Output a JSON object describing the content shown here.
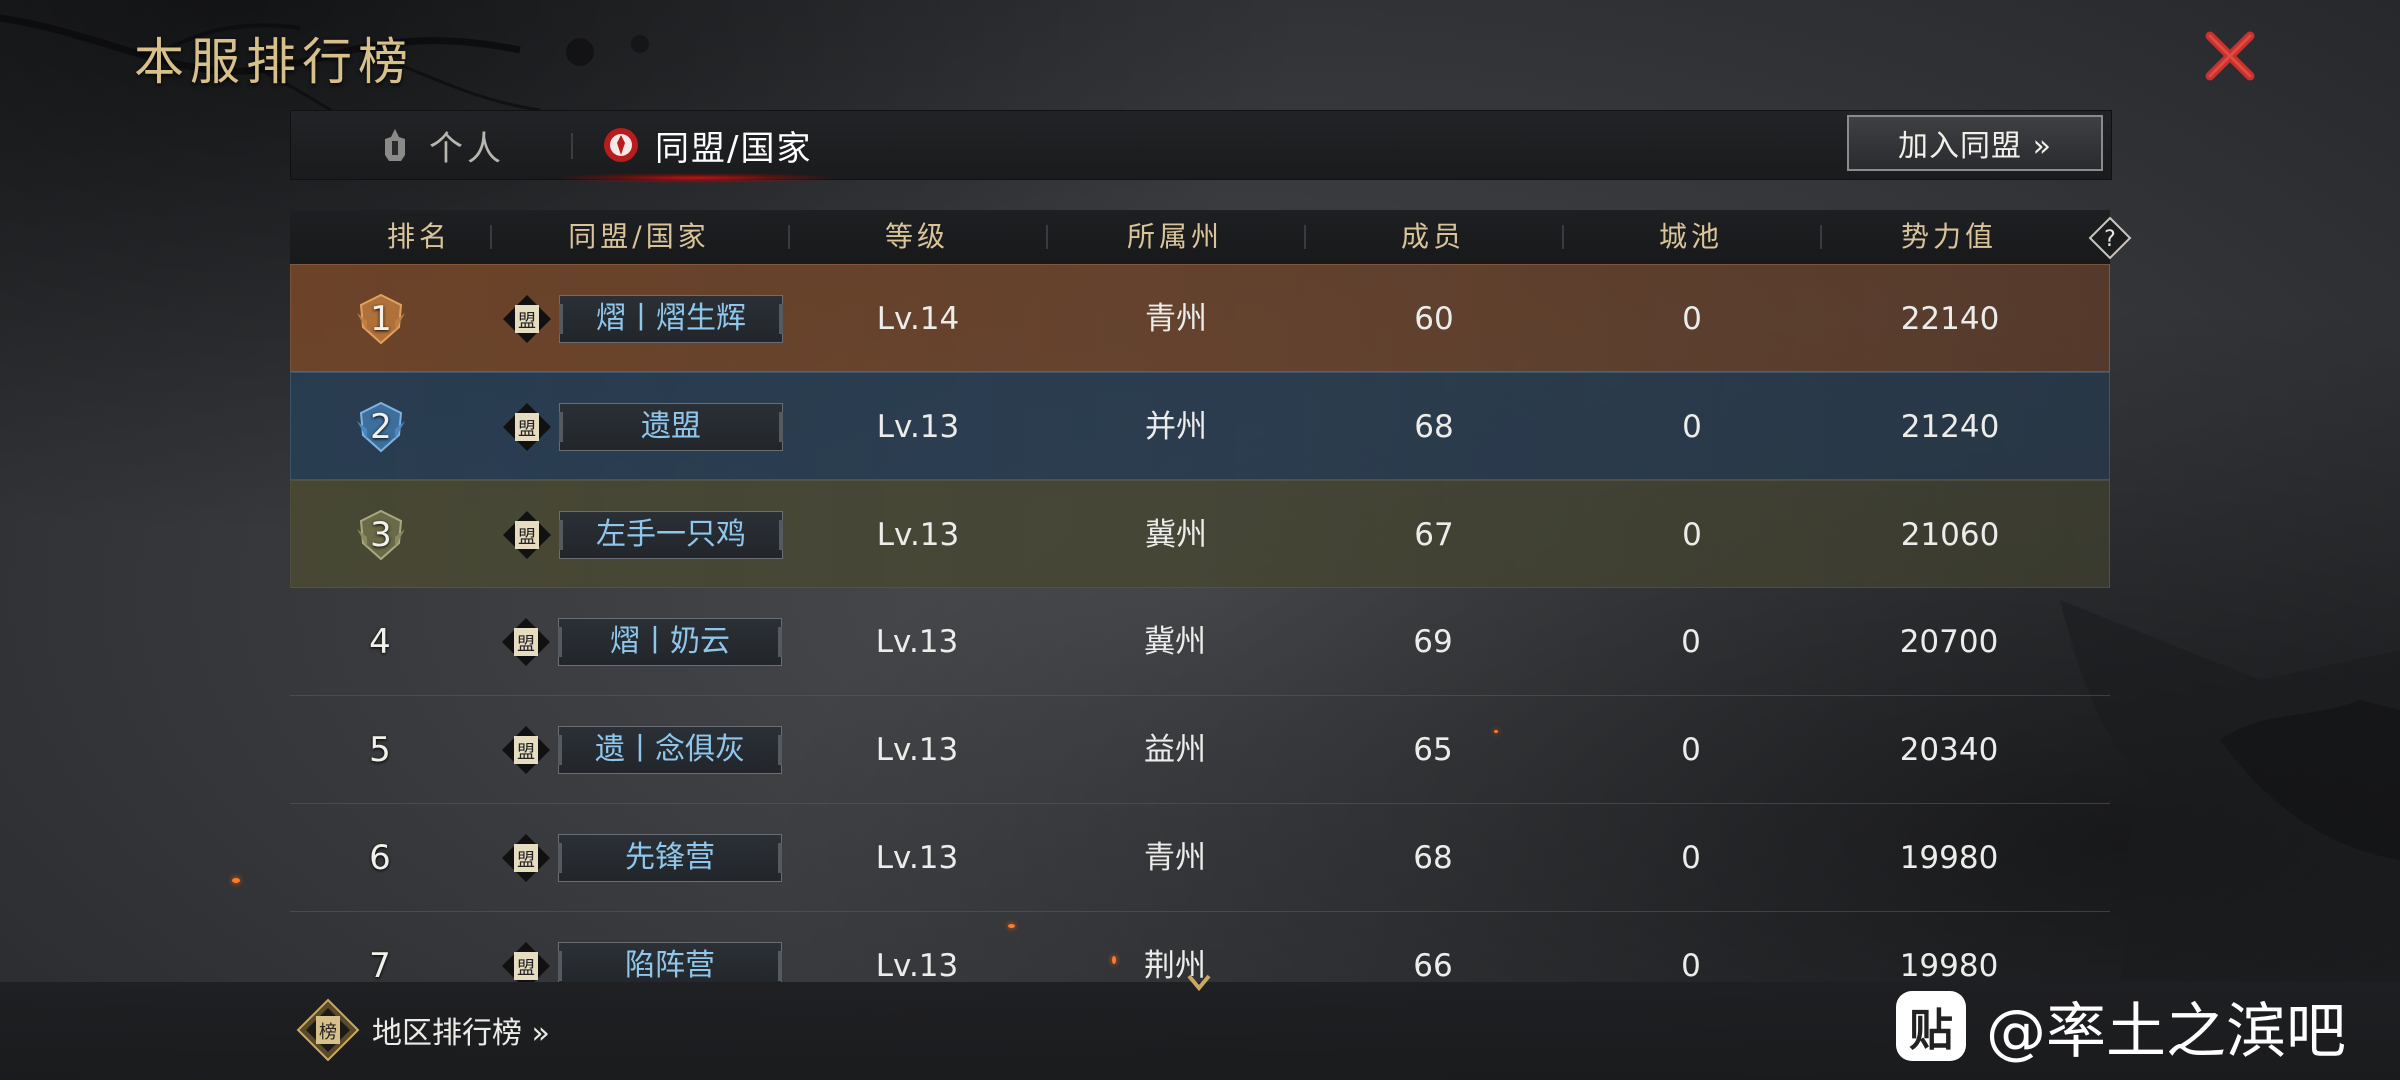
{
  "page_title": "本服排行榜",
  "tabs": [
    {
      "label": "个人",
      "active": false
    },
    {
      "label": "同盟/国家",
      "active": true
    }
  ],
  "join_button": "加入同盟 »",
  "columns": [
    "排名",
    "同盟/国家",
    "等级",
    "所属州",
    "成员",
    "城池",
    "势力值"
  ],
  "alliance_badge_char": "盟",
  "rows": [
    {
      "rank": "1",
      "name": "熠丨熠生辉",
      "level": "Lv.14",
      "state": "青州",
      "members": "60",
      "cities": "0",
      "power": "22140"
    },
    {
      "rank": "2",
      "name": "遗盟",
      "level": "Lv.13",
      "state": "并州",
      "members": "68",
      "cities": "0",
      "power": "21240"
    },
    {
      "rank": "3",
      "name": "左手一只鸡",
      "level": "Lv.13",
      "state": "冀州",
      "members": "67",
      "cities": "0",
      "power": "21060"
    },
    {
      "rank": "4",
      "name": "熠丨奶云",
      "level": "Lv.13",
      "state": "冀州",
      "members": "69",
      "cities": "0",
      "power": "20700"
    },
    {
      "rank": "5",
      "name": "遗丨念俱灰",
      "level": "Lv.13",
      "state": "益州",
      "members": "65",
      "cities": "0",
      "power": "20340"
    },
    {
      "rank": "6",
      "name": "先锋营",
      "level": "Lv.13",
      "state": "青州",
      "members": "68",
      "cities": "0",
      "power": "19980"
    },
    {
      "rank": "7",
      "name": "陷阵营",
      "level": "Lv.13",
      "state": "荆州",
      "members": "66",
      "cities": "0",
      "power": "19980"
    }
  ],
  "region_button": "地区排行榜 »",
  "region_badge_char": "榜",
  "watermark": {
    "logo_char": "贴",
    "text": "@率土之滨吧"
  },
  "colors": {
    "title_gold": "#d8c08a",
    "alliance_name_blue": "#8fc7ec",
    "close_red": "#c8322e",
    "rank1_bronze": "#b0703a",
    "rank2_blue": "#4a88c0",
    "rank3_olive": "#8a8a60"
  }
}
